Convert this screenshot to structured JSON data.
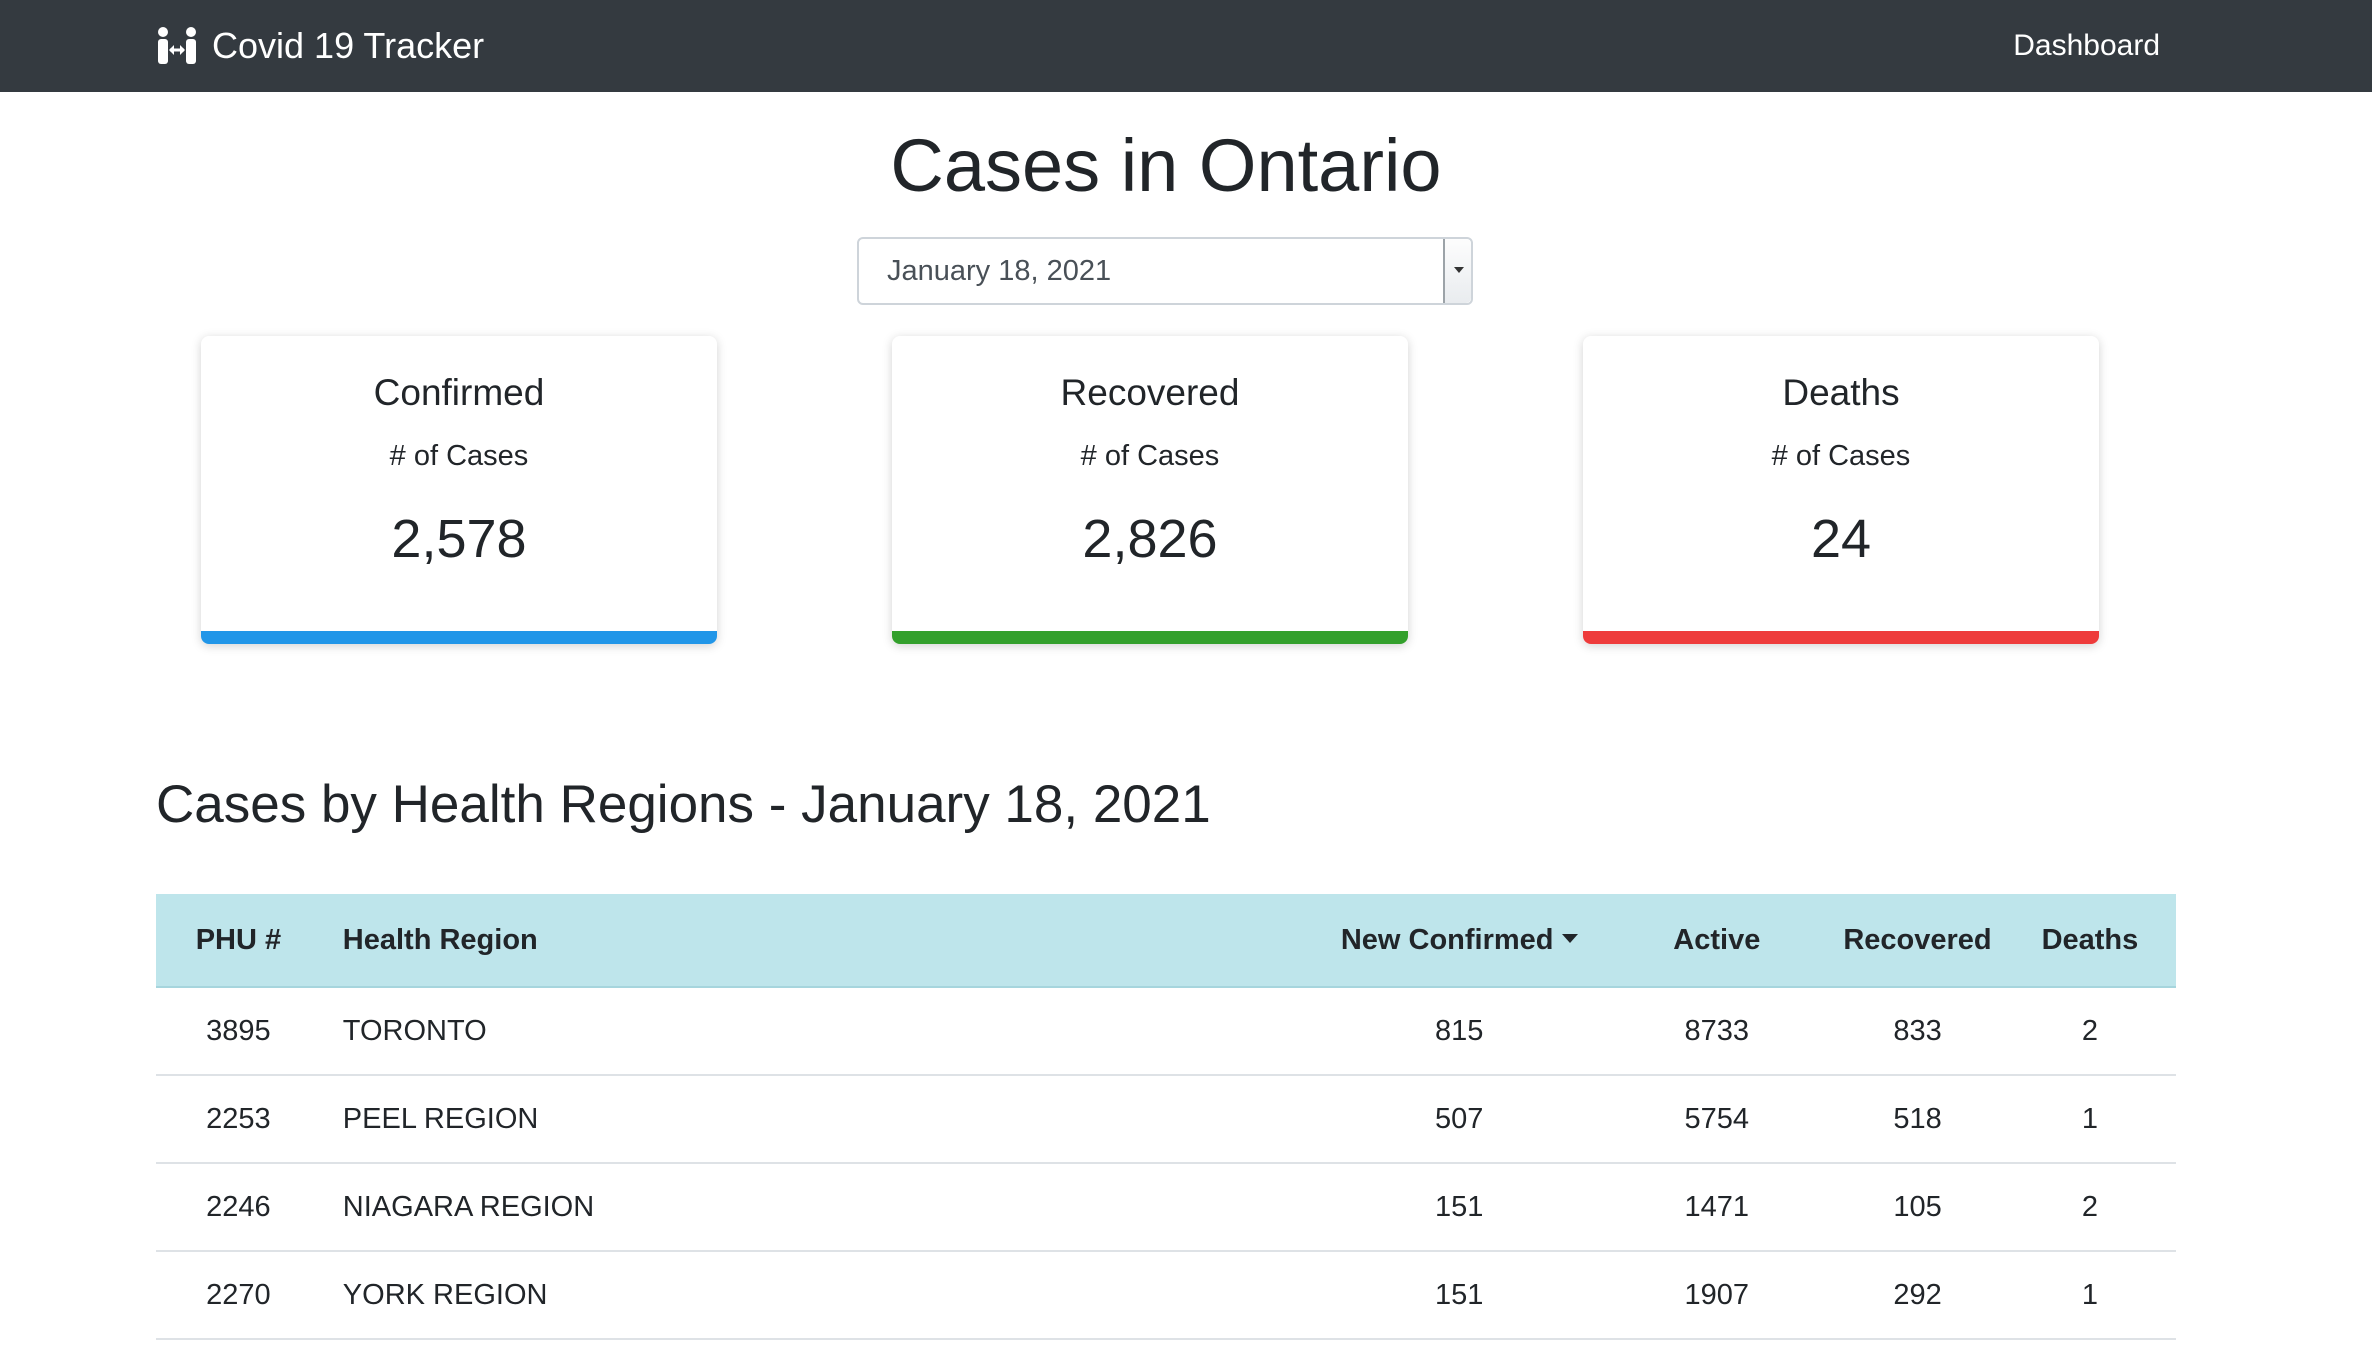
{
  "navbar": {
    "brand": "Covid 19 Tracker",
    "brand_icon": "people-distancing-icon",
    "links": [
      {
        "label": "Dashboard"
      }
    ]
  },
  "page": {
    "title": "Cases in Ontario"
  },
  "date_select": {
    "value": "January 18, 2021"
  },
  "cards": [
    {
      "title": "Confirmed",
      "subtitle": "# of Cases",
      "value": "2,578",
      "color": "#2196e8"
    },
    {
      "title": "Recovered",
      "subtitle": "# of Cases",
      "value": "2,826",
      "color": "#33a02c"
    },
    {
      "title": "Deaths",
      "subtitle": "# of Cases",
      "value": "24",
      "color": "#ee3b3b"
    }
  ],
  "regions": {
    "title": "Cases by Health Regions - January 18, 2021",
    "columns": [
      "PHU #",
      "Health Region",
      "New Confirmed",
      "Active",
      "Recovered",
      "Deaths"
    ],
    "sorted_column": "New Confirmed",
    "sort_direction": "descending",
    "rows": [
      {
        "phu": "3895",
        "region": "TORONTO",
        "new_confirmed": "815",
        "active": "8733",
        "recovered": "833",
        "deaths": "2"
      },
      {
        "phu": "2253",
        "region": "PEEL REGION",
        "new_confirmed": "507",
        "active": "5754",
        "recovered": "518",
        "deaths": "1"
      },
      {
        "phu": "2246",
        "region": "NIAGARA REGION",
        "new_confirmed": "151",
        "active": "1471",
        "recovered": "105",
        "deaths": "2"
      },
      {
        "phu": "2270",
        "region": "YORK REGION",
        "new_confirmed": "151",
        "active": "1907",
        "recovered": "292",
        "deaths": "1"
      }
    ]
  },
  "colors": {
    "navbar_bg": "#343a40",
    "table_header_bg": "#bee5eb"
  }
}
